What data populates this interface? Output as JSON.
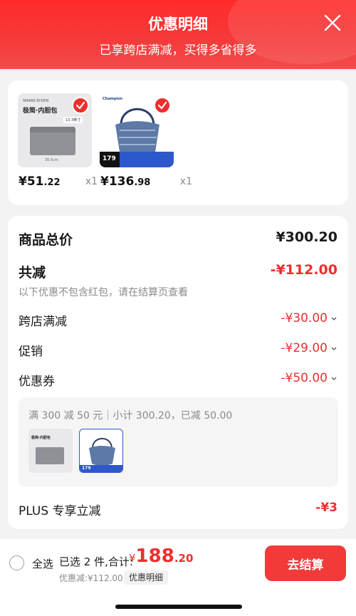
{
  "header": {
    "title": "优惠明细",
    "subtitle": "已享跨店满减，买得多省得多"
  },
  "products": [
    {
      "thumb_label": "极简·内胆包",
      "brand_text": "SMARK RYDEN",
      "size_text": "13.3英寸",
      "dim_text": "35.5cm",
      "price_int": "¥51",
      "price_dec": ".22",
      "qty": "x1"
    },
    {
      "brand_text": "Champion",
      "promo_text": "179",
      "price_int": "¥136",
      "price_dec": ".98",
      "qty": "x1"
    }
  ],
  "summary": {
    "total_label": "商品总价",
    "total_value": "¥300.20",
    "reduce_label": "共减",
    "reduce_value": "-¥112.00",
    "note": "以下优惠不包含红包，请在结算页查看",
    "cross_store_label": "跨店满减",
    "cross_store_value": "-¥30.00",
    "promo_label": "促销",
    "promo_value": "-¥29.00",
    "coupon_label": "优惠券",
    "coupon_value": "-¥50.00",
    "detail_text": "满 300 减 50 元｜小计 300.20，已减 50.00",
    "plus_label": "PLUS 专享立减",
    "plus_value": "-¥3"
  },
  "bottom": {
    "select_all": "全选",
    "selected": "已选 2 件,合计:",
    "total_currency": "¥",
    "total_int": "188",
    "total_dec": ".20",
    "discount": "优惠减:¥112.00",
    "detail_link": "优惠明细",
    "checkout": "去结算"
  },
  "colors": {
    "accent": "#ee2e2e",
    "header": "#f53a3a"
  },
  "icons": {
    "close": "close-icon",
    "check": "check-icon",
    "chevron": "chevron-down-icon",
    "radio": "radio-unchecked-icon"
  }
}
